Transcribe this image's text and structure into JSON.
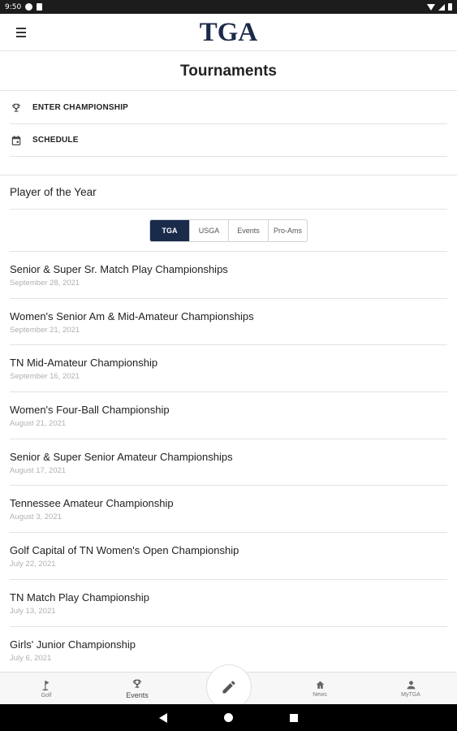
{
  "status_bar": {
    "time": "9:50"
  },
  "header": {
    "logo": "TGA"
  },
  "page": {
    "title": "Tournaments"
  },
  "actions": [
    {
      "label": "ENTER CHAMPIONSHIP",
      "icon": "trophy-icon"
    },
    {
      "label": "SCHEDULE",
      "icon": "calendar-icon"
    }
  ],
  "player_of_year": {
    "label": "Player of the Year"
  },
  "segments": [
    {
      "label": "TGA",
      "active": true
    },
    {
      "label": "USGA",
      "active": false
    },
    {
      "label": "Events",
      "active": false
    },
    {
      "label": "Pro-Ams",
      "active": false
    }
  ],
  "tournaments": [
    {
      "title": "Senior & Super Sr. Match Play Championships",
      "date": "September 28, 2021"
    },
    {
      "title": "Women's Senior Am & Mid-Amateur Championships",
      "date": "September 21, 2021"
    },
    {
      "title": "TN Mid-Amateur Championship",
      "date": "September 16, 2021"
    },
    {
      "title": "Women's Four-Ball Championship",
      "date": "August 21, 2021"
    },
    {
      "title": "Senior & Super Senior Amateur Championships",
      "date": "August 17, 2021"
    },
    {
      "title": "Tennessee Amateur Championship",
      "date": "August 3, 2021"
    },
    {
      "title": "Golf Capital of TN Women's Open Championship",
      "date": "July 22, 2021"
    },
    {
      "title": "TN Match Play Championship",
      "date": "July 13, 2021"
    },
    {
      "title": "Girls' Junior Championship",
      "date": "July 6, 2021"
    }
  ],
  "bottom_nav": [
    {
      "label": "Golf",
      "icon": "golf-flag-icon"
    },
    {
      "label": "Events",
      "icon": "trophy-icon"
    },
    {
      "label": "News",
      "icon": "home-icon"
    },
    {
      "label": "MyTGA",
      "icon": "person-icon"
    }
  ],
  "colors": {
    "brand": "#1a2a4a",
    "divider": "#e3e3e3",
    "date_text": "#b0b0b0"
  }
}
